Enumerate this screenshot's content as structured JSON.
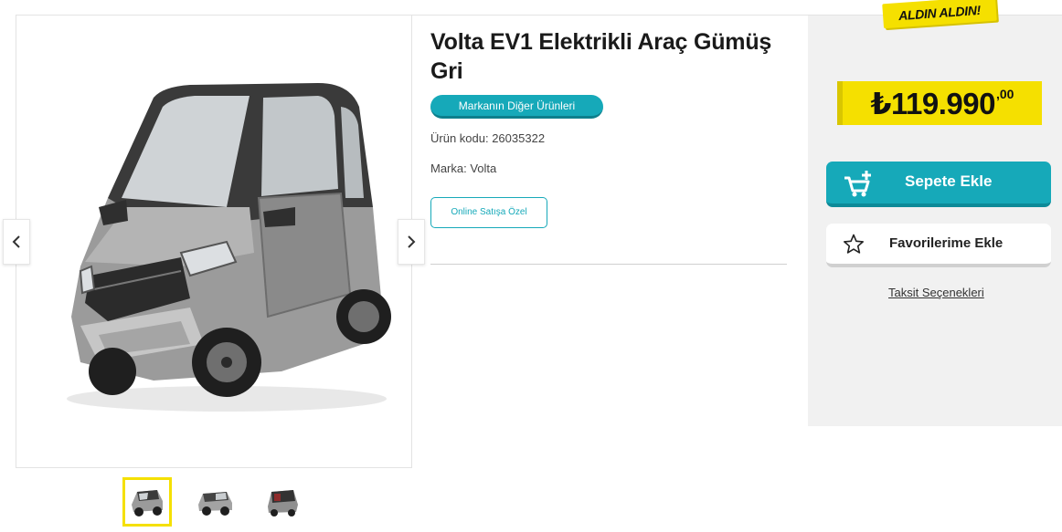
{
  "product": {
    "title": "Volta EV1 Elektrikli Araç Gümüş Gri",
    "brand_button_label": "Markanın Diğer Ürünleri",
    "code_text": "Ürün kodu: 26035322",
    "brand_text": "Marka: Volta",
    "online_badge": "Online Satışa Özel"
  },
  "pricing": {
    "sticker": "ALDIN ALDIN!",
    "price_main": "₺119.990",
    "price_cents": ",00"
  },
  "actions": {
    "add_to_cart": "Sepete Ekle",
    "add_to_favorites": "Favorilerime Ekle",
    "installment_options": "Taksit Seçenekleri"
  },
  "gallery": {
    "prev_icon": "chevron-left-icon",
    "next_icon": "chevron-right-icon",
    "thumbnail_count": 3,
    "active_thumbnail": 1
  },
  "colors": {
    "accent_teal": "#16a9b9",
    "price_yellow": "#f5e000",
    "panel_bg": "#f1f1f1"
  }
}
